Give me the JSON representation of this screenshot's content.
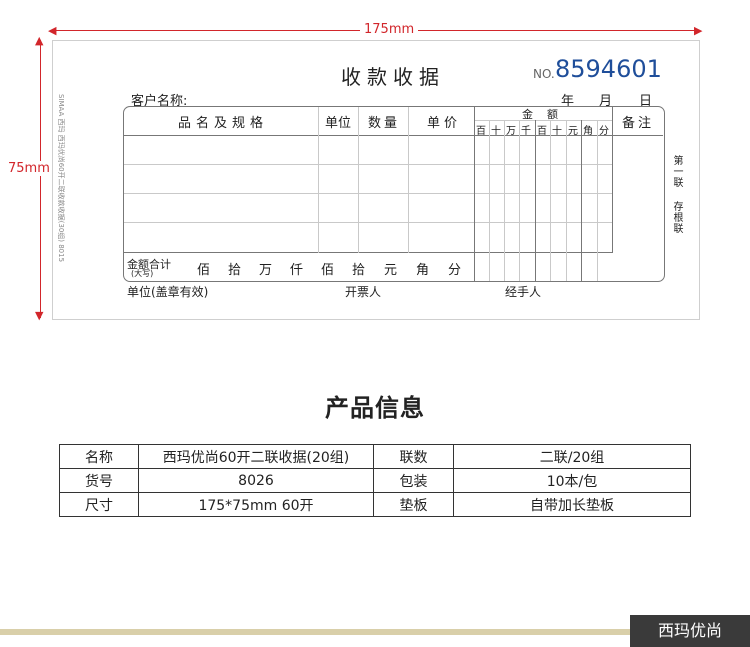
{
  "dims": {
    "width_label": "175mm",
    "height_label": "75mm"
  },
  "receipt": {
    "title": "收款收据",
    "no_prefix": "NO.",
    "number": "8594601",
    "date": {
      "year": "年",
      "month": "月",
      "day": "日"
    },
    "customer_label": "客户名称:",
    "headers": {
      "item": "品名及规格",
      "unit": "单位",
      "qty": "数量",
      "price": "单价",
      "amount": "金额",
      "remark": "备注"
    },
    "digit_cols": [
      "百",
      "十",
      "万",
      "千",
      "百",
      "十",
      "元",
      "角",
      "分"
    ],
    "total_label": "金额合计",
    "total_sub": "(大写)",
    "total_units": [
      "佰",
      "拾",
      "万",
      "仟",
      "佰",
      "拾",
      "元",
      "角",
      "分"
    ],
    "side_left": "SIMAA 西玛    西玛优尚60开二联收款收据(30组)  8015",
    "side_right_1": "第一联",
    "side_right_2": "存根联",
    "footer": {
      "unit_seal": "单位(盖章有效)",
      "issuer": "开票人",
      "handler": "经手人"
    },
    "accent_number_color": "#1f4e9a"
  },
  "info": {
    "title": "产品信息",
    "rows": [
      {
        "k1": "名称",
        "v1": "西玛优尚60开二联收据(20组)",
        "k2": "联数",
        "v2": "二联/20组"
      },
      {
        "k1": "货号",
        "v1": "8026",
        "k2": "包装",
        "v2": "10本/包"
      },
      {
        "k1": "尺寸",
        "v1": "175*75mm  60开",
        "k2": "垫板",
        "v2": "自带加长垫板"
      }
    ]
  },
  "brand": "西玛优尚"
}
